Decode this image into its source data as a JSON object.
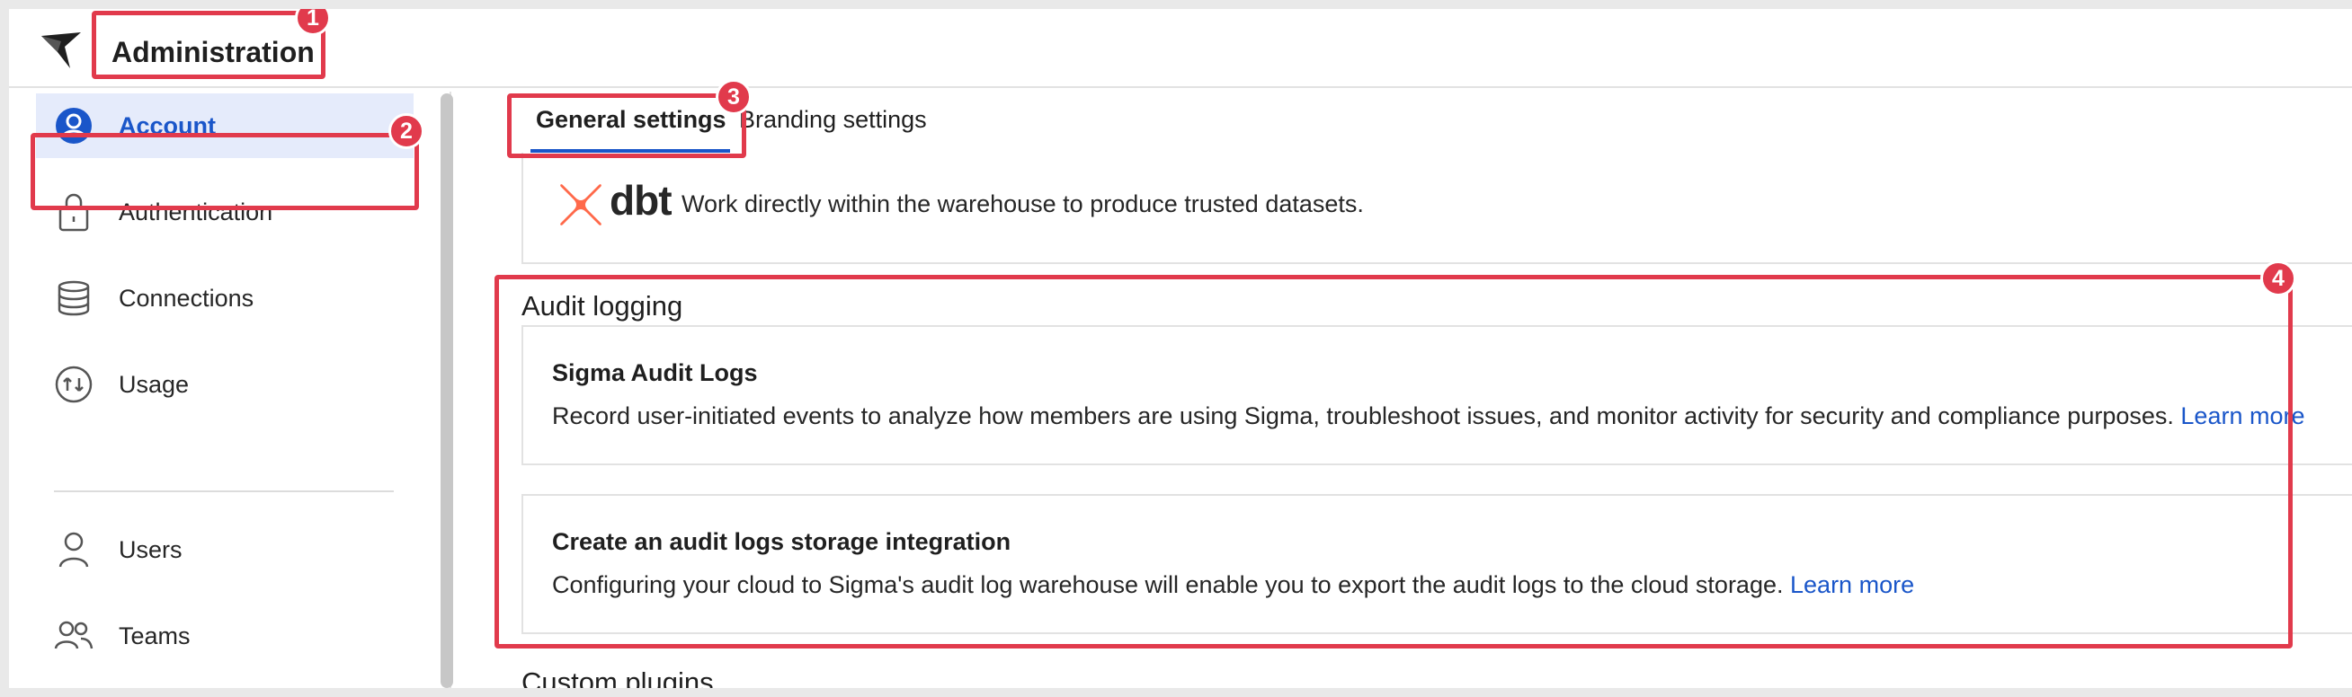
{
  "app": {
    "title": "Administration"
  },
  "sidebar": {
    "items": [
      {
        "label": "Account",
        "icon": "account-icon",
        "active": true
      },
      {
        "label": "Authentication",
        "icon": "lock-icon"
      },
      {
        "label": "Connections",
        "icon": "database-icon"
      },
      {
        "label": "Usage",
        "icon": "usage-icon"
      },
      {
        "label": "Users",
        "icon": "user-icon"
      },
      {
        "label": "Teams",
        "icon": "team-icon"
      }
    ]
  },
  "tabs": [
    {
      "label": "General settings",
      "active": true
    },
    {
      "label": "Branding settings"
    }
  ],
  "dbt_card": {
    "logo_text": "dbt",
    "text": "Work directly within the warehouse to produce trusted datasets."
  },
  "audit_logging": {
    "title": "Audit logging",
    "cards": [
      {
        "title": "Sigma Audit Logs",
        "text": "Record user-initiated events to analyze how members are using Sigma, troubleshoot issues, and monitor activity for security and compliance purposes.",
        "link": "Learn more"
      },
      {
        "title": "Create an audit logs storage integration",
        "text": "Configuring your cloud to Sigma's audit log warehouse will enable you to export the audit logs to the cloud storage.",
        "link": "Learn more"
      }
    ]
  },
  "next_section": {
    "title": "Custom plugins"
  },
  "callouts": [
    "1",
    "2",
    "3",
    "4"
  ],
  "colors": {
    "accent": "#1a56c9",
    "callout": "#e13a4c",
    "active_bg": "#e5ebfb",
    "dbt_orange": "#ff694a"
  }
}
